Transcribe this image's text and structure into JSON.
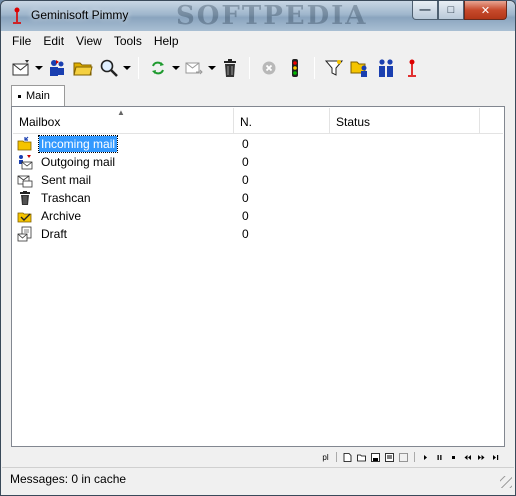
{
  "window": {
    "title": "Geminisoft Pimmy",
    "watermark": "SOFTPEDIA"
  },
  "caption_buttons": {
    "minimize": "—",
    "maximize": "□",
    "close": "✕"
  },
  "menu": [
    "File",
    "Edit",
    "View",
    "Tools",
    "Help"
  ],
  "toolbar": {
    "icons": [
      "new-message-icon",
      "address-book-icon",
      "open-folder-icon",
      "search-icon",
      "send-receive-icon",
      "forward-icon",
      "delete-icon",
      "stop-icon",
      "traffic-light-icon",
      "filter-icon",
      "folders-icon",
      "users-icon",
      "antenna-icon"
    ]
  },
  "tabs": [
    {
      "label": "Main"
    }
  ],
  "list": {
    "columns": [
      "Mailbox",
      "N.",
      "Status"
    ],
    "rows": [
      {
        "icon": "incoming-mail-icon",
        "name": "Incoming mail",
        "count": "0",
        "status": "",
        "selected": true
      },
      {
        "icon": "outgoing-mail-icon",
        "name": "Outgoing mail",
        "count": "0",
        "status": ""
      },
      {
        "icon": "sent-mail-icon",
        "name": "Sent mail",
        "count": "0",
        "status": ""
      },
      {
        "icon": "trashcan-icon",
        "name": "Trashcan",
        "count": "0",
        "status": ""
      },
      {
        "icon": "archive-icon",
        "name": "Archive",
        "count": "0",
        "status": ""
      },
      {
        "icon": "draft-icon",
        "name": "Draft",
        "count": "0",
        "status": ""
      }
    ]
  },
  "status": {
    "text": "Messages: 0 in cache"
  },
  "colors": {
    "selection": "#3399ff",
    "accent_red": "#c74a2c",
    "folder_yellow": "#f2c400"
  }
}
